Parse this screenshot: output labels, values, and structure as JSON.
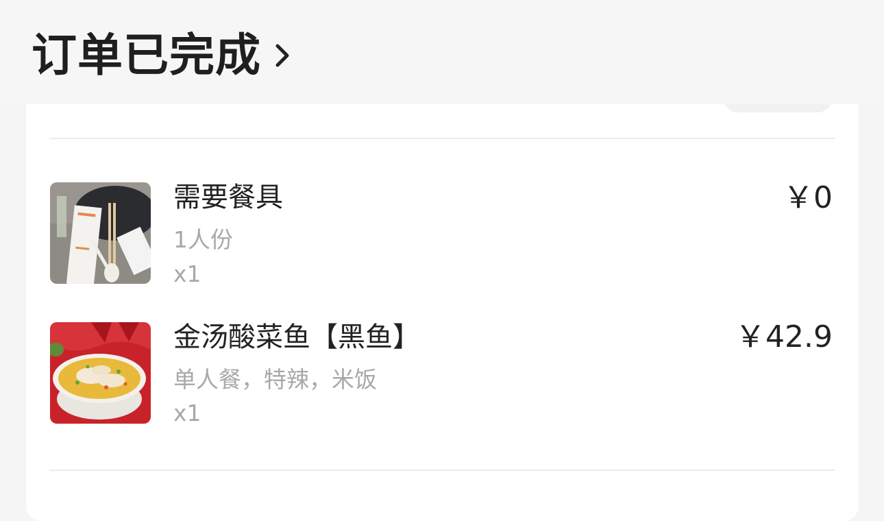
{
  "header": {
    "title": "订单已完成"
  },
  "items": [
    {
      "name": "需要餐具",
      "spec": "1人份",
      "qty": "x1",
      "price": "￥0",
      "thumb_icon": "tableware-photo"
    },
    {
      "name": "金汤酸菜鱼【黑鱼】",
      "spec": "单人餐，特辣，米饭",
      "qty": "x1",
      "price": "￥42.9",
      "thumb_icon": "pickled-fish-photo"
    }
  ],
  "colors": {
    "text_primary": "#222222",
    "text_secondary": "#a8a8a8",
    "header_bg": "#f6f6f6",
    "card_bg": "#ffffff"
  }
}
